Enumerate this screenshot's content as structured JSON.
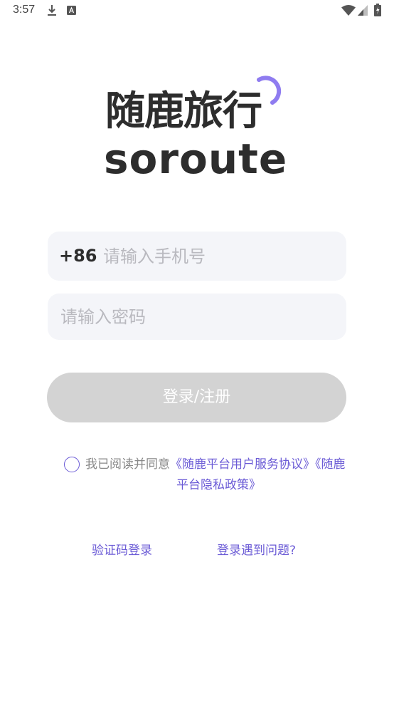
{
  "status_bar": {
    "time": "3:57",
    "icons": [
      "download-icon",
      "a-notification-icon",
      "wifi-icon",
      "signal-icon",
      "battery-icon"
    ]
  },
  "logo": {
    "chinese": "随鹿旅行",
    "english": "soroute",
    "accent_color": "#8f7cf0"
  },
  "form": {
    "country_code": "+86",
    "phone_placeholder": "请输入手机号",
    "phone_value": "",
    "password_placeholder": "请输入密码",
    "password_value": "",
    "login_label": "登录/注册"
  },
  "agreement": {
    "prefix": "我已阅读并同意",
    "link_user": "《随鹿平台用户服务协议》",
    "link_privacy_part1": "《随鹿",
    "link_privacy_part2": "平台隐私政策》",
    "checked": false
  },
  "links": {
    "sms_login": "验证码登录",
    "help": "登录遇到问题?"
  },
  "colors": {
    "link": "#6b5bd6",
    "button_disabled": "#d3d3d3",
    "field_bg": "#f4f5f9"
  }
}
